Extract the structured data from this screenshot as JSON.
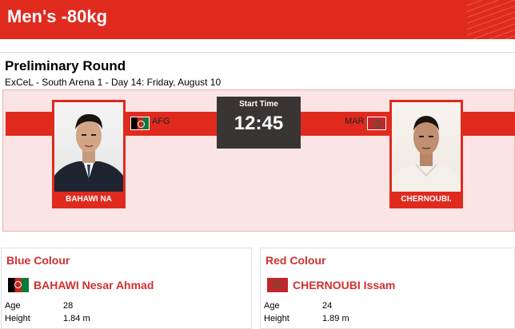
{
  "header": {
    "title": "Men's -80kg"
  },
  "match": {
    "round": "Preliminary Round",
    "venue": "ExCeL - South Arena 1 - Day 14: Friday, August 10",
    "start_label": "Start Time",
    "start_time": "12:45",
    "left": {
      "country": "AFG",
      "short_name": "BAHAWI NA",
      "flag_icon": "afghanistan-flag"
    },
    "right": {
      "country": "MAR",
      "short_name": "CHERNOUBI.",
      "flag_icon": "morocco-flag"
    }
  },
  "blue_card": {
    "title": "Blue Colour",
    "athlete": "BAHAWI Nesar Ahmad",
    "age_label": "Age",
    "age": "28",
    "height_label": "Height",
    "height": "1.84 m"
  },
  "red_card": {
    "title": "Red Colour",
    "athlete": "CHERNOUBI Issam",
    "age_label": "Age",
    "age": "24",
    "height_label": "Height",
    "height": "1.89 m"
  },
  "colors": {
    "accent": "#e02a1e",
    "panel": "#fbe4e4",
    "time_box": "#3a3535",
    "card_title": "#d32f2f"
  }
}
